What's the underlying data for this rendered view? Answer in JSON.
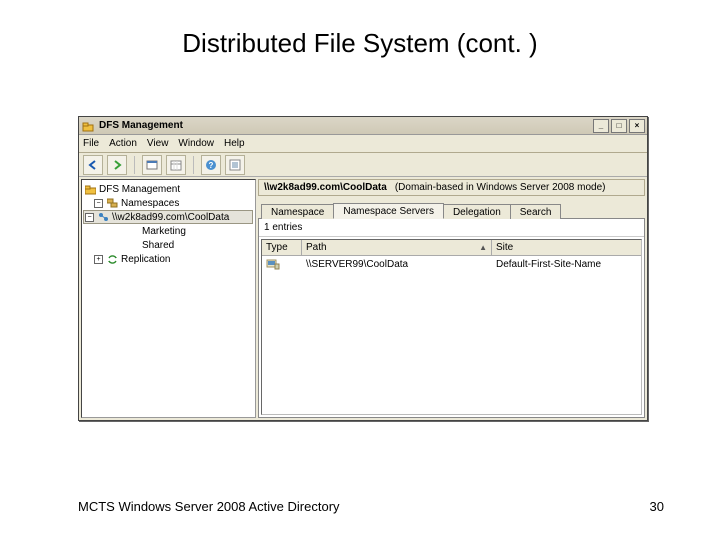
{
  "slide": {
    "title": "Distributed File System (cont. )",
    "footer_left": "MCTS Windows Server 2008 Active Directory",
    "footer_right": "30"
  },
  "window": {
    "title": "DFS Management",
    "controls": {
      "min": "_",
      "max": "□",
      "close": "×"
    }
  },
  "menu": {
    "file": "File",
    "action": "Action",
    "view": "View",
    "window": "Window",
    "help": "Help"
  },
  "tree": {
    "root": "DFS Management",
    "namespaces": "Namespaces",
    "ns1": "\\\\w2k8ad99.com\\CoolData",
    "child1": "Marketing",
    "child2": "Shared",
    "replication": "Replication"
  },
  "pathbar": {
    "path": "\\\\w2k8ad99.com\\CoolData",
    "mode": "(Domain-based in Windows Server 2008 mode)"
  },
  "tabs": {
    "t1": "Namespace",
    "t2": "Namespace Servers",
    "t3": "Delegation",
    "t4": "Search"
  },
  "content": {
    "count": "1 entries"
  },
  "columns": {
    "type": "Type",
    "path": "Path",
    "site": "Site"
  },
  "row1": {
    "path": "\\\\SERVER99\\CoolData",
    "site": "Default-First-Site-Name"
  }
}
